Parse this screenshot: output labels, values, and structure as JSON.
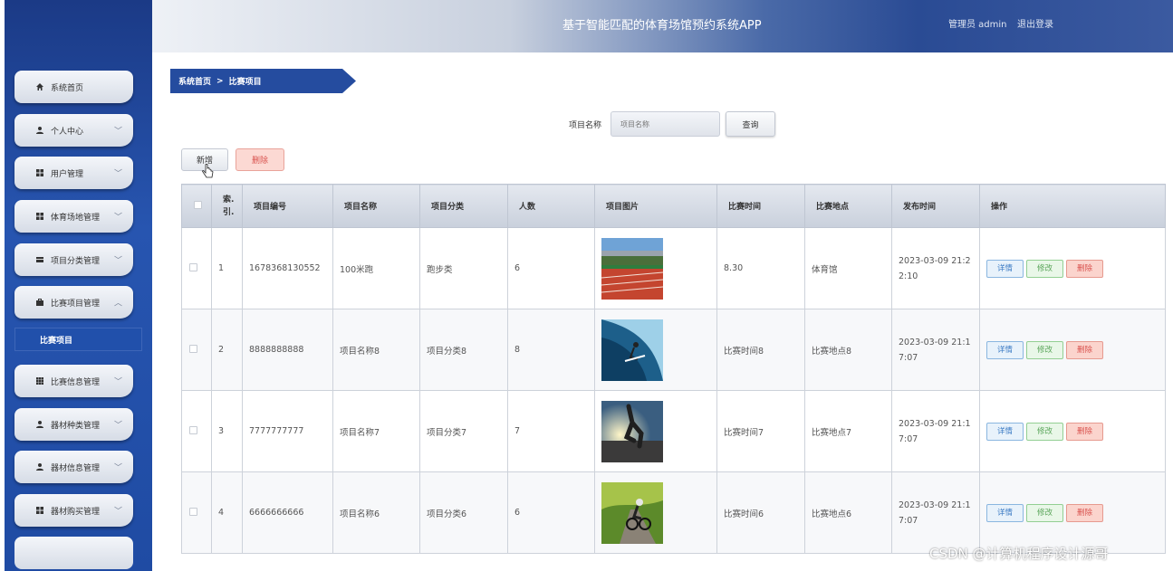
{
  "header": {
    "title": "基于智能匹配的体育场馆预约系统APP",
    "admin": "管理员 admin",
    "logout": "退出登录"
  },
  "sidebar": {
    "items": [
      {
        "label": "系统首页",
        "icon": "home-icon"
      },
      {
        "label": "个人中心",
        "icon": "person-icon"
      },
      {
        "label": "用户管理",
        "icon": "grid-icon"
      },
      {
        "label": "体育场地管理",
        "icon": "grid-icon"
      },
      {
        "label": "项目分类管理",
        "icon": "card-icon"
      },
      {
        "label": "比赛项目管理",
        "icon": "briefcase-icon"
      },
      {
        "label": "比赛信息管理",
        "icon": "table-icon"
      },
      {
        "label": "器材种类管理",
        "icon": "person-icon"
      },
      {
        "label": "器材信息管理",
        "icon": "person-icon"
      },
      {
        "label": "器材购买管理",
        "icon": "grid-icon"
      }
    ],
    "active_sub": "比赛项目"
  },
  "breadcrumb": {
    "home": "系统首页",
    "sep": ">",
    "current": "比赛项目"
  },
  "search": {
    "label": "项目名称",
    "placeholder": "项目名称",
    "button": "查询"
  },
  "actions": {
    "add": "新增",
    "delete": "删除"
  },
  "table": {
    "columns": [
      "索引",
      "项目编号",
      "项目名称",
      "项目分类",
      "人数",
      "项目图片",
      "比赛时间",
      "比赛地点",
      "发布时间",
      "操作"
    ],
    "index_header": "索.\n引.",
    "rows": [
      {
        "idx": "1",
        "code": "1678368130552",
        "name": "100米跑",
        "category": "跑步类",
        "people": "6",
        "time": "8.30",
        "place": "体育馆",
        "published": "2023-03-09 21:2\n2:10",
        "img": "track"
      },
      {
        "idx": "2",
        "code": "8888888888",
        "name": "项目名称8",
        "category": "项目分类8",
        "people": "8",
        "time": "比赛时间8",
        "place": "比赛地点8",
        "published": "2023-03-09 21:1\n7:07",
        "img": "surf"
      },
      {
        "idx": "3",
        "code": "7777777777",
        "name": "项目名称7",
        "category": "项目分类7",
        "people": "7",
        "time": "比赛时间7",
        "place": "比赛地点7",
        "published": "2023-03-09 21:1\n7:07",
        "img": "runner"
      },
      {
        "idx": "4",
        "code": "6666666666",
        "name": "项目名称6",
        "category": "项目分类6",
        "people": "6",
        "time": "比赛时间6",
        "place": "比赛地点6",
        "published": "2023-03-09 21:1\n7:07",
        "img": "cyclist"
      }
    ],
    "ops": {
      "detail": "详情",
      "edit": "修改",
      "delete": "删除"
    }
  },
  "watermark": "CSDN @计算机程序设计源哥"
}
